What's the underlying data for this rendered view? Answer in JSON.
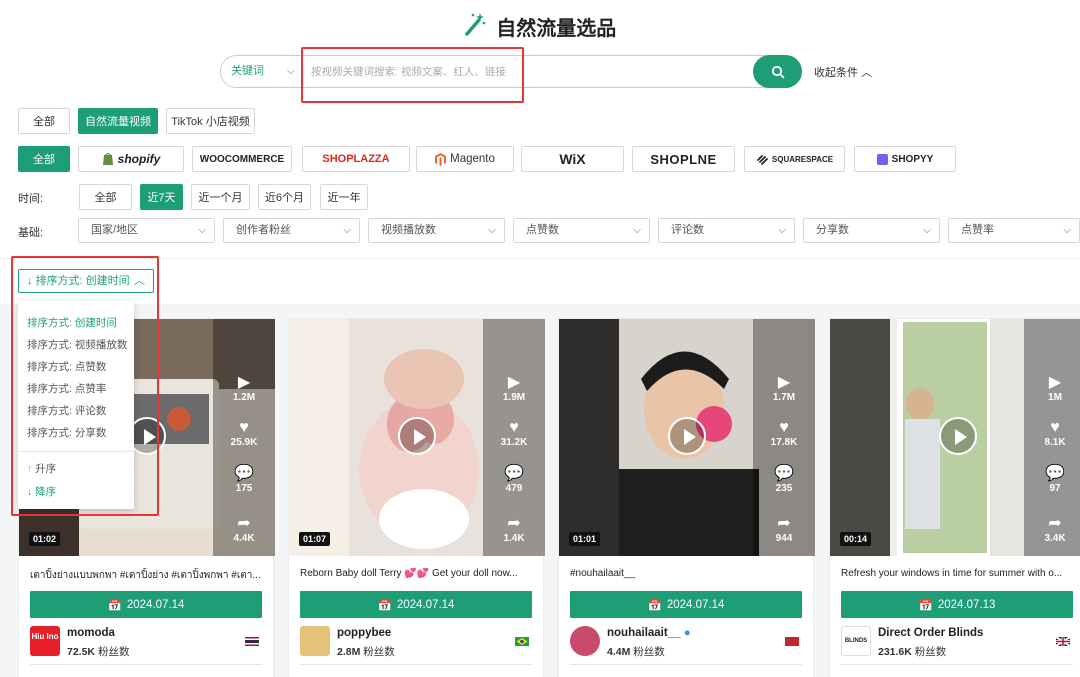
{
  "header": {
    "title": "自然流量选品",
    "icon": "magic-wand-icon"
  },
  "search": {
    "type_select": "关键词",
    "placeholder": "按视频关键词搜索: 视频文案、红人、链接",
    "button_icon": "search-icon",
    "collapse_label": "收起条件"
  },
  "source_tabs": [
    {
      "label": "全部",
      "active": false
    },
    {
      "label": "自然流量视频",
      "active": true
    },
    {
      "label": "TikTok 小店视频",
      "active": false
    }
  ],
  "platforms": [
    {
      "label": "全部",
      "active": true
    },
    {
      "label": "shopify"
    },
    {
      "label": "WOOCOMMERCE"
    },
    {
      "label": "SHOPLAZZA"
    },
    {
      "label": "Magento"
    },
    {
      "label": "WiX"
    },
    {
      "label": "SHOPLNE"
    },
    {
      "label": "SQUARESPACE"
    },
    {
      "label": "SHOPYY"
    }
  ],
  "time": {
    "label": "时间:",
    "options": [
      {
        "label": "全部",
        "active": false
      },
      {
        "label": "近7天",
        "active": true
      },
      {
        "label": "近一个月",
        "active": false
      },
      {
        "label": "近6个月",
        "active": false
      },
      {
        "label": "近一年",
        "active": false
      }
    ]
  },
  "basic": {
    "label": "基础:",
    "filters": [
      "国家/地区",
      "创作者粉丝",
      "视频播放数",
      "点赞数",
      "评论数",
      "分享数",
      "点赞率"
    ]
  },
  "sort": {
    "label": "排序方式: 创建时间",
    "options": [
      "排序方式: 创建时间",
      "排序方式: 视频播放数",
      "排序方式: 点赞数",
      "排序方式: 点赞率",
      "排序方式: 评论数",
      "排序方式: 分享数"
    ],
    "selected_index": 0,
    "order_options": [
      "升序",
      "降序"
    ],
    "order_selected_index": 1
  },
  "cards": [
    {
      "plays": "1.2M",
      "likes": "25.9K",
      "comments": "175",
      "shares": "4.4K",
      "duration": "01:02",
      "caption": "เตาปิ้งย่างแบบพกพา #เตาปิ้งย่าง #เตาปิ้งพกพา #เตา...",
      "date": "2024.07.14",
      "user": "momoda",
      "fans": "72.5K",
      "fans_label": "粉丝数",
      "flag": "th",
      "avatar_text": "Hiu Ino",
      "avatar_color": "#e8202a"
    },
    {
      "plays": "1.9M",
      "likes": "31.2K",
      "comments": "479",
      "shares": "1.4K",
      "duration": "01:07",
      "caption": "Reborn Baby doll Terry 💕💕 Get your doll now...",
      "date": "2024.07.14",
      "user": "poppybee",
      "fans": "2.8M",
      "fans_label": "粉丝数",
      "flag": "br",
      "avatar_color": "#e4c27a"
    },
    {
      "plays": "1.7M",
      "likes": "17.8K",
      "comments": "235",
      "shares": "944",
      "duration": "01:01",
      "caption": "#nouhailaait__",
      "date": "2024.07.14",
      "user": "nouhailaait__",
      "fans": "4.4M",
      "fans_label": "粉丝数",
      "flag": "ma",
      "avatar_color": "#c94a6a"
    },
    {
      "plays": "1M",
      "likes": "8.1K",
      "comments": "97",
      "shares": "3.4K",
      "duration": "00:14",
      "caption": "Refresh your windows in time for summer with o...",
      "date": "2024.07.13",
      "user": "Direct Order Blinds",
      "fans": "231.6K",
      "fans_label": "粉丝数",
      "flag": "gb",
      "avatar_text": "BLINDS",
      "avatar_color": "#ffffff"
    }
  ]
}
